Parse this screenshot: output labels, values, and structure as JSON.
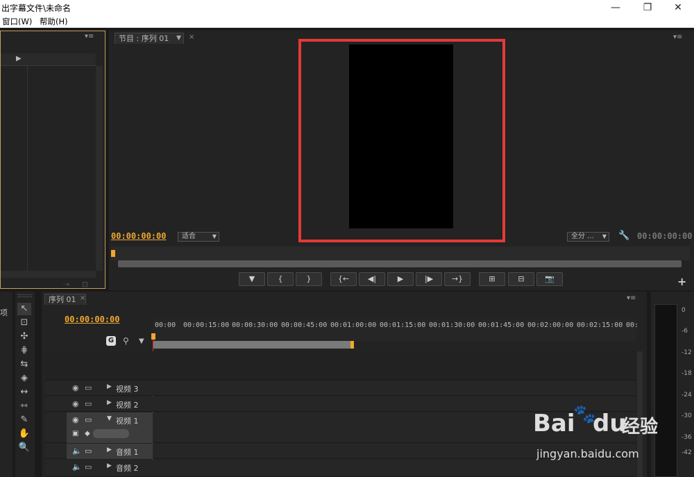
{
  "window": {
    "title": "出字幕文件\\未命名",
    "minimize": "—",
    "maximize": "❐",
    "close": "✕"
  },
  "menu": {
    "items": [
      "窗口(W)",
      "帮助(H)"
    ]
  },
  "program_monitor": {
    "tab_label": "节目 : 序列 01",
    "timecode_left": "00:00:00:00",
    "fit_dropdown": "适合",
    "quality_dropdown": "全分 ...",
    "timecode_right": "00:00:00:00",
    "buttons": [
      "▼",
      "{",
      "}",
      "{←",
      "◀|",
      "▶",
      "|▶",
      "→}",
      "⊞",
      "⊟",
      "📷"
    ],
    "add": "+"
  },
  "left_panel": {
    "tab_label": "项"
  },
  "timeline": {
    "tab_label": "序列 01",
    "timecode": "00:00:00:00",
    "ruler": [
      "00:00",
      "00:00:15:00",
      "00:00:30:00",
      "00:00:45:00",
      "00:01:00:00",
      "00:01:15:00",
      "00:01:30:00",
      "00:01:45:00",
      "00:02:00:00",
      "00:02:15:00",
      "00:"
    ],
    "tracks": [
      {
        "name": "视频 3"
      },
      {
        "name": "视频 2"
      },
      {
        "name": "视频 1"
      },
      {
        "name": "音频 1"
      },
      {
        "name": "音频 2"
      }
    ]
  },
  "audio_meter": {
    "ticks": [
      "0",
      "-6",
      "-12",
      "-18",
      "-24",
      "-30",
      "-36",
      "-42"
    ]
  },
  "watermark": {
    "brand": "Bai",
    "brand2": "du",
    "label": "经验",
    "url": "jingyan.baidu.com"
  },
  "colors": {
    "accent": "#f0a830",
    "highlight": "#e53935",
    "panel": "#232323"
  }
}
